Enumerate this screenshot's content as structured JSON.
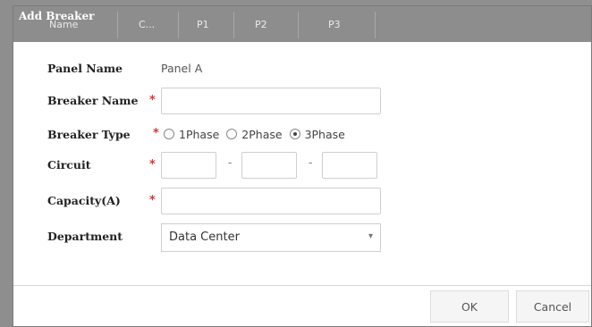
{
  "background": {
    "columns": [
      "Name",
      "C...",
      "P1",
      "P2",
      "P3"
    ]
  },
  "dialog": {
    "title": "Add Breaker",
    "fields": {
      "panel_name": {
        "label": "Panel Name",
        "value": "Panel A"
      },
      "breaker_name": {
        "label": "Breaker Name",
        "required": "*",
        "value": ""
      },
      "breaker_type": {
        "label": "Breaker Type",
        "required": "*",
        "options": [
          "1Phase",
          "2Phase",
          "3Phase"
        ],
        "selected": "3Phase"
      },
      "circuit": {
        "label": "Circuit",
        "required": "*",
        "separator": "-"
      },
      "capacity": {
        "label": "Capacity(A)",
        "required": "*",
        "value": ""
      },
      "department": {
        "label": "Department",
        "value": "Data Center"
      }
    },
    "buttons": {
      "ok": "OK",
      "cancel": "Cancel"
    }
  },
  "colors": {
    "required": "#d23a3a",
    "titlebar": "#8d8d8d"
  }
}
